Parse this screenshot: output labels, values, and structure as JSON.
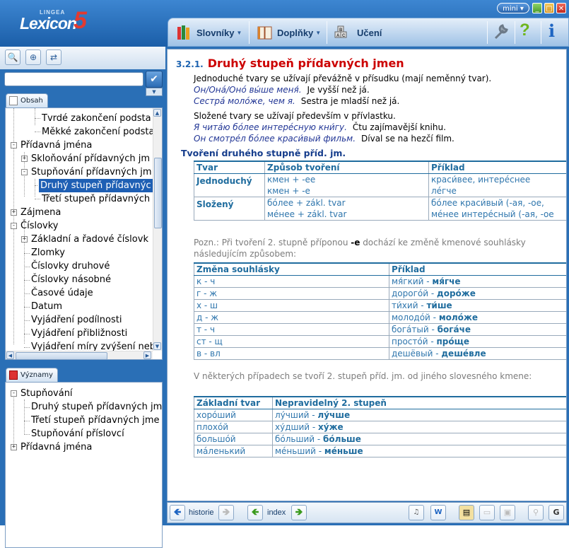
{
  "app": {
    "brand_small": "LINGEA",
    "brand_name": "Lexicon",
    "brand_num": "5",
    "mini_label": "mini ▾"
  },
  "toolbar": {
    "items": [
      {
        "label": "Slovníky"
      },
      {
        "label": "Doplňky"
      },
      {
        "label": "Učení"
      }
    ]
  },
  "search": {
    "value": ""
  },
  "tabs": {
    "contents": "Obsah",
    "meanings": "Významy"
  },
  "tree": [
    {
      "label": "Tvrdé zakončení podsta"
    },
    {
      "label": "Měkké zakončení podsta"
    },
    {
      "label": "Přídavná jména"
    },
    {
      "label": "Skloňování přídavných jm"
    },
    {
      "label": "Stupňování přídavných jm"
    },
    {
      "label": "Druhý stupeň přídavnýc"
    },
    {
      "label": "Třetí stupeň přídavných"
    },
    {
      "label": "Zájmena"
    },
    {
      "label": "Číslovky"
    },
    {
      "label": "Základní a řadové číslovk"
    },
    {
      "label": "Zlomky"
    },
    {
      "label": "Číslovky druhové"
    },
    {
      "label": "Číslovky násobné"
    },
    {
      "label": "Časové údaje"
    },
    {
      "label": "Datum"
    },
    {
      "label": "Vyjádření podílnosti"
    },
    {
      "label": "Vyjádření přibližnosti"
    },
    {
      "label": "Vyjádření míry zvýšení neb"
    }
  ],
  "meanings": [
    {
      "label": "Stupňování"
    },
    {
      "label": "Druhý stupeň přídavných jm"
    },
    {
      "label": "Třetí stupeň přídavných jme"
    },
    {
      "label": "Stupňování příslovcí"
    },
    {
      "label": "Přídavná jména"
    }
  ],
  "content": {
    "section_num": "3.2.1.",
    "title": "Druhý stupeň přídavných jmen",
    "p1": "Jednoduché tvary se užívají převážně v přísudku (mají neměnný tvar).",
    "p1_ex1_ru": "Он/Онá/Онó вы́ше меня́.",
    "p1_ex1_cs": "Je vyšší než já.",
    "p1_ex2_ru": "Сестрá молóже, чем я.",
    "p1_ex2_cs": "Sestra je mladší než já.",
    "p2": "Složené tvary se užívají především v přívlastku.",
    "p2_ex1_ru": "Я читáю бóлее интерéсную кни́гу.",
    "p2_ex1_cs": "Čtu zajímavější knihu.",
    "p2_ex2_ru": "Он смотрéл бóлее краси́вый фильм.",
    "p2_ex2_cs": "Díval se na hezčí film.",
    "subheading": "Tvoření druhého stupně příd. jm.",
    "t1": {
      "headers": [
        "Tvar",
        "Způsob tvoření",
        "Příklad"
      ],
      "rows": [
        {
          "c1": "Jednoduchý",
          "c2a": "кмен + -ее",
          "c2b": "кмен + -е",
          "c3a": "краси́вее, интерéснее",
          "c3b": "лéгче"
        },
        {
          "c1": "Složený",
          "c2a": "бóлее + zákl. tvar",
          "c2b": "мéнее + zákl. tvar",
          "c3a": "бóлее краси́вый (-ая, -oe,",
          "c3b": "мéнее интерéсный (-ая, -ое"
        }
      ]
    },
    "note1_a": "Pozn.: Při tvoření 2. stupně příponou ",
    "note1_b": "-е",
    "note1_c": " dochází ke změně kmenové souhlásky následujícím způsobem:",
    "t2": {
      "headers": [
        "Změna souhlásky",
        "Příklad"
      ],
      "rows": [
        {
          "c1": "к - ч",
          "base": "мя́гкий - ",
          "res": "мя́гче"
        },
        {
          "c1": "г - ж",
          "base": "дорогóй - ",
          "res": "дорóже"
        },
        {
          "c1": "х - ш",
          "base": "ти́хий - ",
          "res": "ти́ше"
        },
        {
          "c1": "д - ж",
          "base": "молодóй - ",
          "res": "молóже"
        },
        {
          "c1": "т - ч",
          "base": "богáтый - ",
          "res": "богáче"
        },
        {
          "c1": "ст - щ",
          "base": "простóй - ",
          "res": "прóще"
        },
        {
          "c1": "в - вл",
          "base": "дешёвый - ",
          "res": "дешéвле"
        }
      ]
    },
    "note2": "V některých případech se tvoří 2. stupeň příd. jm. od jiného slovesného kmene:",
    "t3": {
      "headers": [
        "Základní tvar",
        "Nepravidelný 2. stupeň"
      ],
      "rows": [
        {
          "c1": "хорóший",
          "base": "лу́чший - ",
          "res": "лу́чше"
        },
        {
          "c1": "плохóй",
          "base": "ху́дший - ",
          "res": "ху́же"
        },
        {
          "c1": "большóй",
          "base": "бóльший - ",
          "res": "бóльше"
        },
        {
          "c1": "мáленький",
          "base": "мéньший - ",
          "res": "мéньше"
        }
      ]
    }
  },
  "nav": {
    "history": "historie",
    "index": "index"
  }
}
